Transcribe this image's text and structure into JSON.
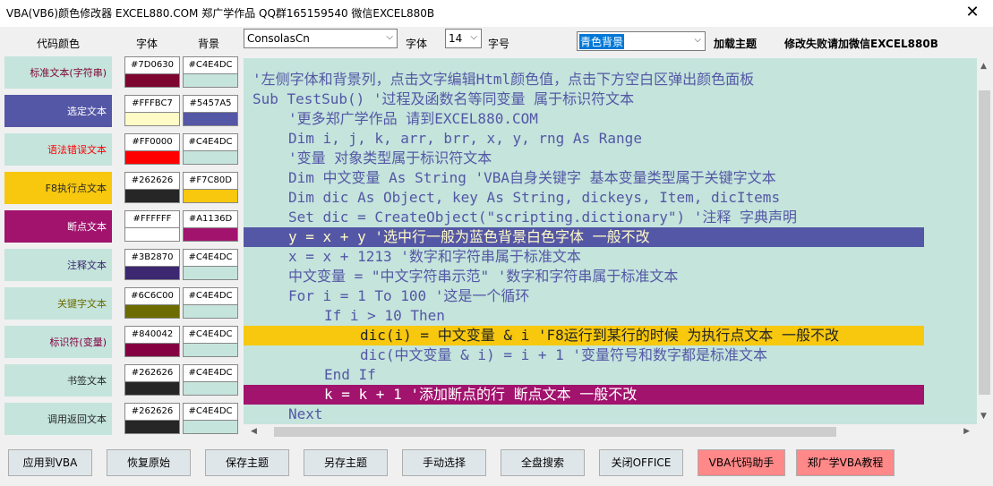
{
  "window": {
    "title": "VBA(VB6)颜色修改器 EXCEL880.COM 郑广学作品  QQ群165159540 微信EXCEL880B",
    "close_glyph": "✕"
  },
  "headers": {
    "code_color": "代码颜色",
    "font": "字体",
    "background": "背景"
  },
  "toolbar": {
    "font_select": "ConsolasCn",
    "font_label": "字体",
    "size_select": "14",
    "size_label": "字号",
    "theme_select": "青色背景",
    "load_theme": "加载主题",
    "fail_note": "修改失败请加微信EXCEL880B"
  },
  "rows": [
    {
      "label": "标准文本(字符串)",
      "fg": "#7D0630",
      "bg": "#C4E4DC",
      "label_bg": "#C4E4DC",
      "label_fg": "#7D0630"
    },
    {
      "label": "选定文本",
      "fg": "#FFFBC7",
      "bg": "#5457A5",
      "label_bg": "#5457A5",
      "label_fg": "#FFFFFF"
    },
    {
      "label": "语法错误文本",
      "fg": "#FF0000",
      "bg": "#C4E4DC",
      "label_bg": "#C4E4DC",
      "label_fg": "#FF0000"
    },
    {
      "label": "F8执行点文本",
      "fg": "#262626",
      "bg": "#F7C80D",
      "label_bg": "#F7C80D",
      "label_fg": "#262626"
    },
    {
      "label": "断点文本",
      "fg": "#FFFFFF",
      "bg": "#A1136D",
      "label_bg": "#A1136D",
      "label_fg": "#FFFFFF"
    },
    {
      "label": "注释文本",
      "fg": "#3B2870",
      "bg": "#C4E4DC",
      "label_bg": "#C4E4DC",
      "label_fg": "#3B2870"
    },
    {
      "label": "关键字文本",
      "fg": "#6C6C00",
      "bg": "#C4E4DC",
      "label_bg": "#C4E4DC",
      "label_fg": "#6C6C00"
    },
    {
      "label": "标识符(变量)",
      "fg": "#840042",
      "bg": "#C4E4DC",
      "label_bg": "#C4E4DC",
      "label_fg": "#840042"
    },
    {
      "label": "书签文本",
      "fg": "#262626",
      "bg": "#C4E4DC",
      "label_bg": "#C4E4DC",
      "label_fg": "#262626"
    },
    {
      "label": "调用返回文本",
      "fg": "#262626",
      "bg": "#C4E4DC",
      "label_bg": "#C4E4DC",
      "label_fg": "#262626"
    }
  ],
  "code_lines": [
    {
      "text": "'左侧字体和背景列，点击文字编辑Html颜色值，点击下方空白区弹出颜色面板",
      "indent": 0,
      "hl": ""
    },
    {
      "text": "Sub TestSub() '过程及函数名等同变量 属于标识符文本",
      "indent": 0,
      "hl": ""
    },
    {
      "text": "'更多郑广学作品 请到EXCEL880.COM",
      "indent": 1,
      "hl": ""
    },
    {
      "text": "Dim i, j, k, arr, brr, x, y, rng As Range",
      "indent": 1,
      "hl": ""
    },
    {
      "text": "'变量 对象类型属于标识符文本",
      "indent": 1,
      "hl": ""
    },
    {
      "text": "Dim 中文变量 As String 'VBA自身关键字 基本变量类型属于关键字文本",
      "indent": 1,
      "hl": ""
    },
    {
      "text": "Dim dic As Object, key As String, dickeys, Item, dicItems",
      "indent": 1,
      "hl": ""
    },
    {
      "text": "Set dic = CreateObject(\"scripting.dictionary\") '注释 字典声明",
      "indent": 1,
      "hl": ""
    },
    {
      "text": "y = x + y '选中行一般为蓝色背景白色字体 一般不改",
      "indent": 1,
      "hl": "sel"
    },
    {
      "text": "x = x + 1213 '数字和字符串属于标准文本",
      "indent": 1,
      "hl": ""
    },
    {
      "text": "中文变量 = \"中文字符串示范\" '数字和字符串属于标准文本",
      "indent": 1,
      "hl": ""
    },
    {
      "text": "For i = 1 To 100 '这是一个循环",
      "indent": 1,
      "hl": ""
    },
    {
      "text": "If i > 10 Then",
      "indent": 2,
      "hl": ""
    },
    {
      "text": "dic(i) = 中文变量 & i 'F8运行到某行的时候 为执行点文本 一般不改",
      "indent": 3,
      "hl": "exec"
    },
    {
      "text": "dic(中文变量 & i) = i + 1 '变量符号和数字都是标准文本",
      "indent": 3,
      "hl": ""
    },
    {
      "text": "End If",
      "indent": 2,
      "hl": ""
    },
    {
      "text": "k = k + 1 '添加断点的行 断点文本 一般不改",
      "indent": 2,
      "hl": "bp"
    },
    {
      "text": "Next",
      "indent": 1,
      "hl": ""
    }
  ],
  "buttons": [
    {
      "label": "应用到VBA",
      "red": false
    },
    {
      "label": "恢复原始",
      "red": false
    },
    {
      "label": "保存主题",
      "red": false
    },
    {
      "label": "另存主题",
      "red": false
    },
    {
      "label": "手动选择",
      "red": false
    },
    {
      "label": "全盘搜索",
      "red": false
    },
    {
      "label": "关闭OFFICE",
      "red": false
    },
    {
      "label": "VBA代码助手",
      "red": true
    },
    {
      "label": "郑广学VBA教程",
      "red": true
    }
  ],
  "icons": {
    "dropdown": "chevron-down-icon",
    "scroll_up": "▲",
    "scroll_down": "▼",
    "scroll_left": "◀",
    "scroll_right": "▶"
  }
}
